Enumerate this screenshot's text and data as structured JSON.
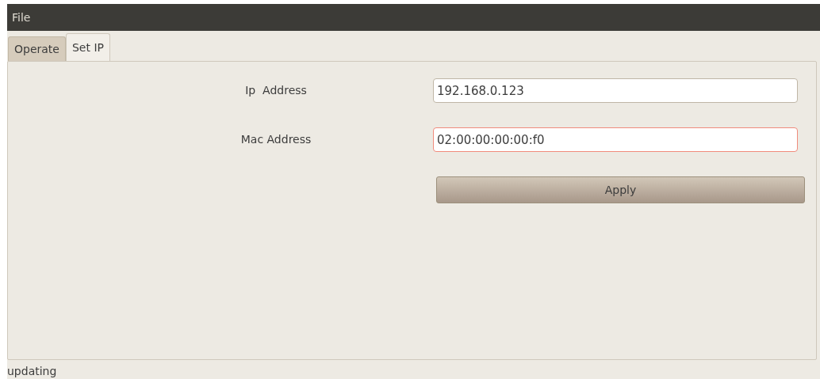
{
  "menu_bar": {
    "items": [
      "File"
    ]
  },
  "tabs": [
    {
      "label": "Operate",
      "selected": false
    },
    {
      "label": "Set IP",
      "selected": true
    }
  ],
  "form": {
    "fields": [
      {
        "label": "Ip  Address",
        "value": "192.168.0.123",
        "focused": false
      },
      {
        "label": "Mac Address",
        "value": "02:00:00:00:00:f0",
        "focused": true
      }
    ],
    "button": "Apply"
  },
  "status_bar": "updating"
}
